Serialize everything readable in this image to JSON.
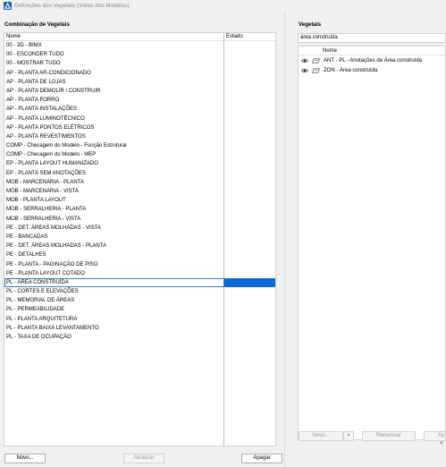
{
  "window": {
    "title": "Definições dos Vegetais (vistas dos Modelos)"
  },
  "combinations": {
    "heading": "Combinação de Vegetais",
    "columns": {
      "name": "Nome",
      "state": "Estado"
    },
    "rows": [
      "00 - 3D - BIMX",
      "00 - ESCONDER TUDO",
      "00 - MOSTRAR TUDO",
      "AP - PLANTA AR-CONDICIONADO",
      "AP - PLANTA DE LOJAS",
      "AP - PLANTA DEMOLIR / CONSTRUIR",
      "AP - PLANTA FORRO",
      "AP - PLANTA INSTALAÇÕES",
      "AP - PLANTA LUMINOTÉCNICO",
      "AP - PLANTA PONTOS ELÉTRICOS",
      "AP - PLANTA REVESTIMENTOS",
      "COMP - Checagem do Modelo - Função Estrutural",
      "COMP - Checagem do Modelo - MEP",
      "EP - PLANTA LAYOUT HUMANIZADO",
      "EP - PLANTA SEM ANOTAÇÕES",
      "MOB - MARCENARIA - PLANTA",
      "MOB - MARCENARIA - VISTA",
      "MOB - PLANTA LAYOUT",
      "MOB - SERRALHERIA - PLANTA",
      "MOB - SERRALHERIA - VISTA",
      "PE - DET. ÁREAS MOLHADAS - VISTA",
      "PE - BANCADAS",
      "PE - DET. ÁREAS MOLHADAS - PLANTA",
      "PE - DETALHES",
      "PE - PLANTA - PAGINAÇÃO DE PISO",
      "PE - PLANTA LAYOUT COTADO",
      "PL - ÁREA CONSTRUÍDA",
      "PL - CORTES E ELEVAÇÕES",
      "PL - MEMORIAL DE ÁREAS",
      "PL - PERMEABILIDADE",
      "PL - PLANTA ARQUITETURA",
      "PL - PLANTA BAIXA LEVANTAMENTO",
      "PL - TAXA DE OCUPAÇÃO"
    ],
    "selected_index": 26,
    "buttons": {
      "new": "Novo...",
      "update": "Atualizar",
      "delete": "Apagar"
    }
  },
  "layers": {
    "heading": "Vegetais",
    "filter_value": "área construída",
    "column": "Nome",
    "rows": [
      {
        "name": "ANT - PL - Anotações de Área construída",
        "icons": [
          "eye-icon",
          "layer-icon"
        ]
      },
      {
        "name": "ZON - Área construída",
        "icons": [
          "eye-icon",
          "layer-icon"
        ]
      }
    ],
    "buttons": {
      "new": "Novo...",
      "rename": "Renomear",
      "partial": "Ap"
    }
  },
  "colors": {
    "selection": "#0a6ad6",
    "selection_border": "#3a7bd5"
  }
}
